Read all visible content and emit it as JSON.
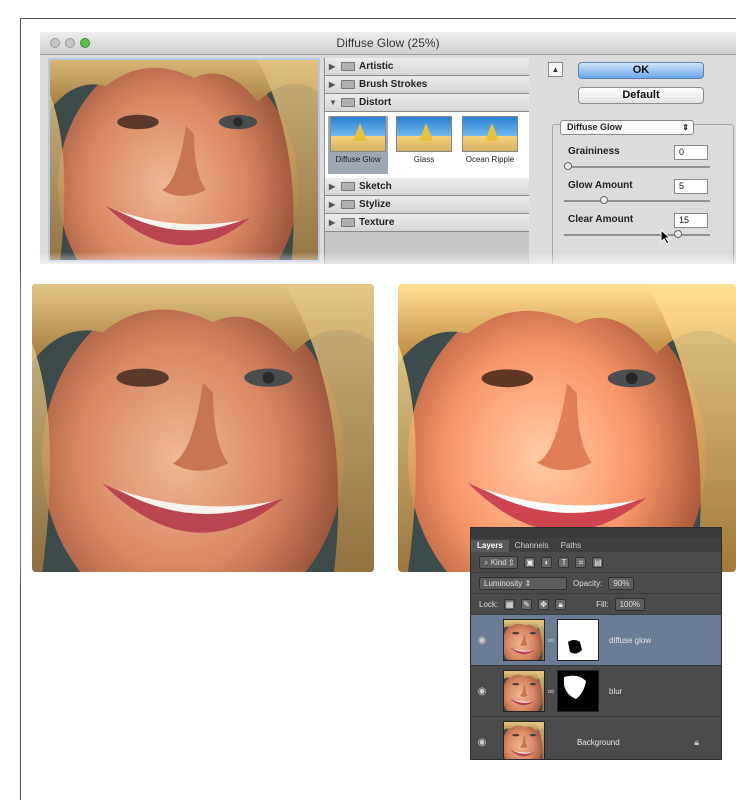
{
  "window": {
    "title": "Diffuse Glow (25%)"
  },
  "gallery": {
    "categories_top": [
      "Artistic",
      "Brush Strokes",
      "Distort"
    ],
    "thumbnails": [
      "Diffuse Glow",
      "Glass",
      "Ocean Ripple"
    ],
    "categories_bottom": [
      "Sketch",
      "Stylize",
      "Texture"
    ]
  },
  "controls": {
    "ok_label": "OK",
    "default_label": "Default",
    "filter_select": "Diffuse Glow",
    "params": [
      {
        "label": "Graininess",
        "value": "0",
        "slider": 0.0
      },
      {
        "label": "Glow Amount",
        "value": "5",
        "slider": 0.25
      },
      {
        "label": "Clear Amount",
        "value": "15",
        "slider": 0.75
      }
    ]
  },
  "layers_panel": {
    "tabs": [
      "Layers",
      "Channels",
      "Paths"
    ],
    "kind": "Kind",
    "blend_mode": "Luminosity",
    "opacity_label": "Opacity:",
    "opacity_value": "90%",
    "lock_label": "Lock:",
    "fill_label": "Fill:",
    "fill_value": "100%",
    "layers": [
      {
        "name": "diffuse glow",
        "selected": true
      },
      {
        "name": "blur",
        "selected": false
      },
      {
        "name": "Background",
        "selected": false
      }
    ]
  },
  "colors": {
    "ok_button": "#6aa8e8",
    "panel_bg": "#4b4b4b",
    "selected_layer": "#6b7c95"
  }
}
